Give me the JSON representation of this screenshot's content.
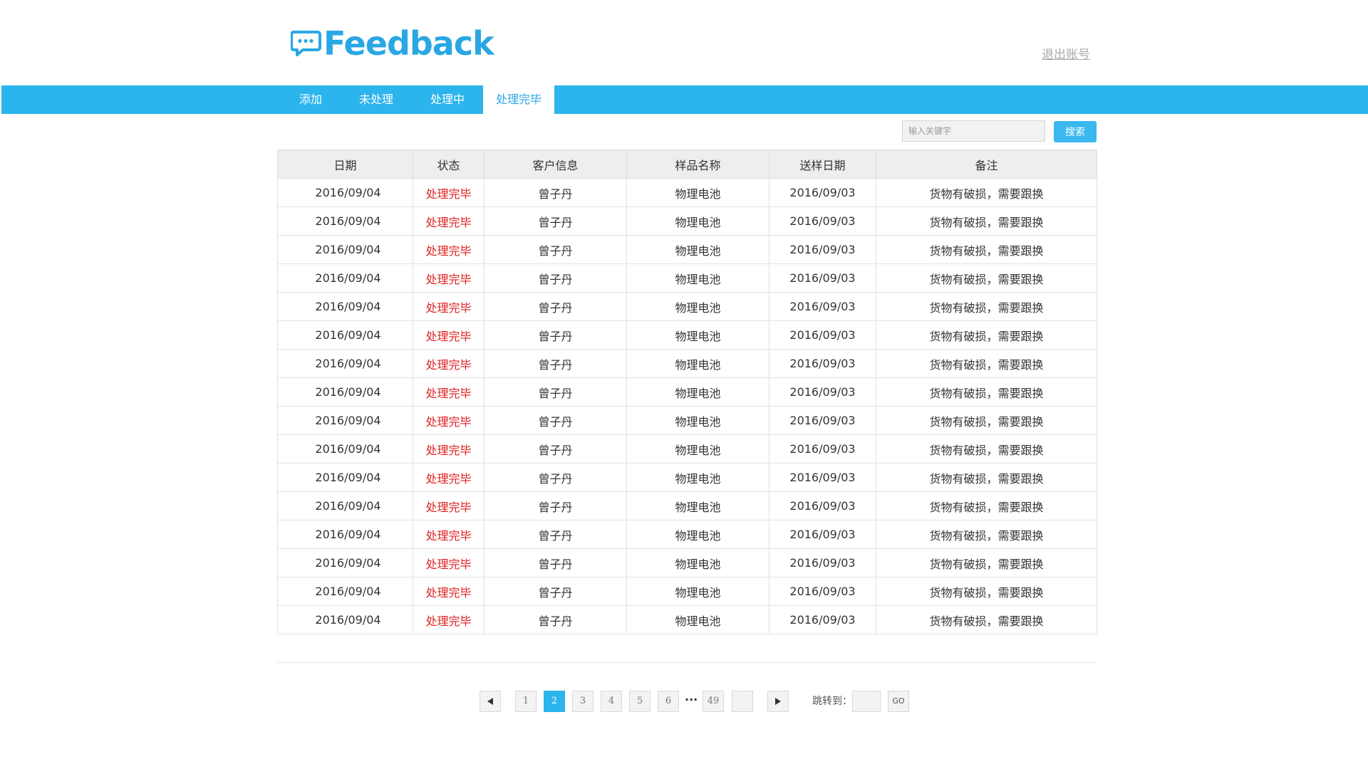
{
  "header": {
    "logo_text": "Feedback",
    "logo_icon": "chat-bubble-icon",
    "logout_label": "退出账号"
  },
  "nav": {
    "tabs": [
      {
        "label": "添加",
        "active": false
      },
      {
        "label": "未处理",
        "active": false
      },
      {
        "label": "处理中",
        "active": false
      },
      {
        "label": "处理完毕",
        "active": true
      }
    ]
  },
  "search": {
    "placeholder": "输入关键字",
    "value": "",
    "button_label": "搜索"
  },
  "table": {
    "headers": [
      "日期",
      "状态",
      "客户信息",
      "样品名称",
      "送样日期",
      "备注"
    ],
    "rows": [
      [
        "2016/09/04",
        "处理完毕",
        "曾子丹",
        "物理电池",
        "2016/09/03",
        "货物有破损，需要跟换"
      ],
      [
        "2016/09/04",
        "处理完毕",
        "曾子丹",
        "物理电池",
        "2016/09/03",
        "货物有破损，需要跟换"
      ],
      [
        "2016/09/04",
        "处理完毕",
        "曾子丹",
        "物理电池",
        "2016/09/03",
        "货物有破损，需要跟换"
      ],
      [
        "2016/09/04",
        "处理完毕",
        "曾子丹",
        "物理电池",
        "2016/09/03",
        "货物有破损，需要跟换"
      ],
      [
        "2016/09/04",
        "处理完毕",
        "曾子丹",
        "物理电池",
        "2016/09/03",
        "货物有破损，需要跟换"
      ],
      [
        "2016/09/04",
        "处理完毕",
        "曾子丹",
        "物理电池",
        "2016/09/03",
        "货物有破损，需要跟换"
      ],
      [
        "2016/09/04",
        "处理完毕",
        "曾子丹",
        "物理电池",
        "2016/09/03",
        "货物有破损，需要跟换"
      ],
      [
        "2016/09/04",
        "处理完毕",
        "曾子丹",
        "物理电池",
        "2016/09/03",
        "货物有破损，需要跟换"
      ],
      [
        "2016/09/04",
        "处理完毕",
        "曾子丹",
        "物理电池",
        "2016/09/03",
        "货物有破损，需要跟换"
      ],
      [
        "2016/09/04",
        "处理完毕",
        "曾子丹",
        "物理电池",
        "2016/09/03",
        "货物有破损，需要跟换"
      ],
      [
        "2016/09/04",
        "处理完毕",
        "曾子丹",
        "物理电池",
        "2016/09/03",
        "货物有破损，需要跟换"
      ],
      [
        "2016/09/04",
        "处理完毕",
        "曾子丹",
        "物理电池",
        "2016/09/03",
        "货物有破损，需要跟换"
      ],
      [
        "2016/09/04",
        "处理完毕",
        "曾子丹",
        "物理电池",
        "2016/09/03",
        "货物有破损，需要跟换"
      ],
      [
        "2016/09/04",
        "处理完毕",
        "曾子丹",
        "物理电池",
        "2016/09/03",
        "货物有破损，需要跟换"
      ],
      [
        "2016/09/04",
        "处理完毕",
        "曾子丹",
        "物理电池",
        "2016/09/03",
        "货物有破损，需要跟换"
      ],
      [
        "2016/09/04",
        "处理完毕",
        "曾子丹",
        "物理电池",
        "2016/09/03",
        "货物有破损，需要跟换"
      ]
    ]
  },
  "pagination": {
    "prev_icon": "triangle-left-icon",
    "next_icon": "triangle-right-icon",
    "pages": [
      "1",
      "2",
      "3",
      "4",
      "5",
      "6"
    ],
    "current_page": "2",
    "ellipsis": "···",
    "last_page": "49",
    "blank_page": "",
    "jump_label": "跳转到：",
    "jump_value": "",
    "go_label": "GO"
  },
  "colors": {
    "accent": "#2cb4ec",
    "logo": "#2aa7e4",
    "status_done": "#e02020"
  }
}
